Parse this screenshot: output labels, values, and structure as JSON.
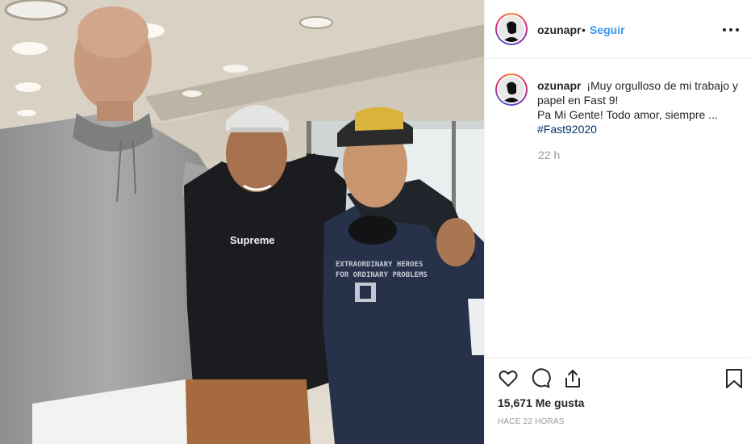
{
  "post": {
    "author": {
      "username": "ozunapr",
      "follow_label": "Seguir",
      "separator": "•",
      "avatar_icon": "profile-silhouette-avatar"
    },
    "photo": {
      "shirt_text_1": "Supreme",
      "shirt_text_2": "EXTRAORDINARY HEROES",
      "shirt_text_3": "FOR ORDINARY PROBLEMS"
    },
    "caption": {
      "username": "ozunapr",
      "line1": "¡Muy orgulloso de mi trabajo y papel en Fast 9!",
      "line2": "Pa Mi Gente! Todo amor, siempre ...",
      "hashtag": "#Fast92020",
      "relative_time": "22 h"
    },
    "actions": {
      "icons": [
        "heart-icon",
        "comment-icon",
        "share-icon",
        "bookmark-icon"
      ],
      "likes_label": "15,671 Me gusta",
      "timestamp": "HACE 22 HORAS"
    },
    "colors": {
      "accent": "#3897f0",
      "hashtag": "#003569",
      "muted": "#999999"
    }
  }
}
